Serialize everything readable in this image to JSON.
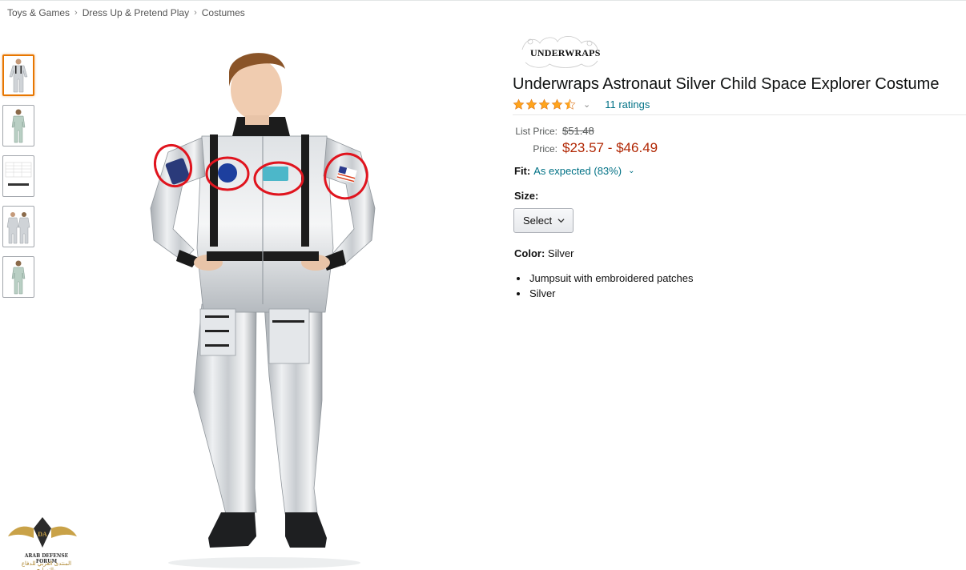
{
  "breadcrumb": {
    "items": [
      "Toys & Games",
      "Dress Up & Pretend Play",
      "Costumes"
    ],
    "separator": "›"
  },
  "thumbnails": {
    "count": 5,
    "selected_index": 0
  },
  "watermark": {
    "line1": "ARAB DEFENSE FORUM",
    "line2": "المنتدى العربي للدفاع والتسليح"
  },
  "product": {
    "brand_logo_text": "UNDERWRAPS",
    "title": "Underwraps Astronaut Silver Child Space Explorer Costume",
    "rating": {
      "stars": 4.5,
      "chevron": "⌄",
      "count_text": "11 ratings"
    },
    "price": {
      "list_label": "List Price:",
      "list_value": "$51.48",
      "price_label": "Price:",
      "price_value": "$23.57 - $46.49"
    },
    "fit": {
      "label": "Fit:",
      "value": "As expected (83%)",
      "chevron": "⌄"
    },
    "size": {
      "label": "Size:",
      "select_label": "Select"
    },
    "color": {
      "label": "Color:",
      "value": "Silver"
    },
    "bullets": [
      "Jumpsuit with embroidered patches",
      "Silver"
    ]
  },
  "colors": {
    "link": "#007185",
    "price": "#B12704",
    "star": "#FFA41C",
    "selected_thumb": "#E77600",
    "annotation_circle": "#E0141E"
  }
}
